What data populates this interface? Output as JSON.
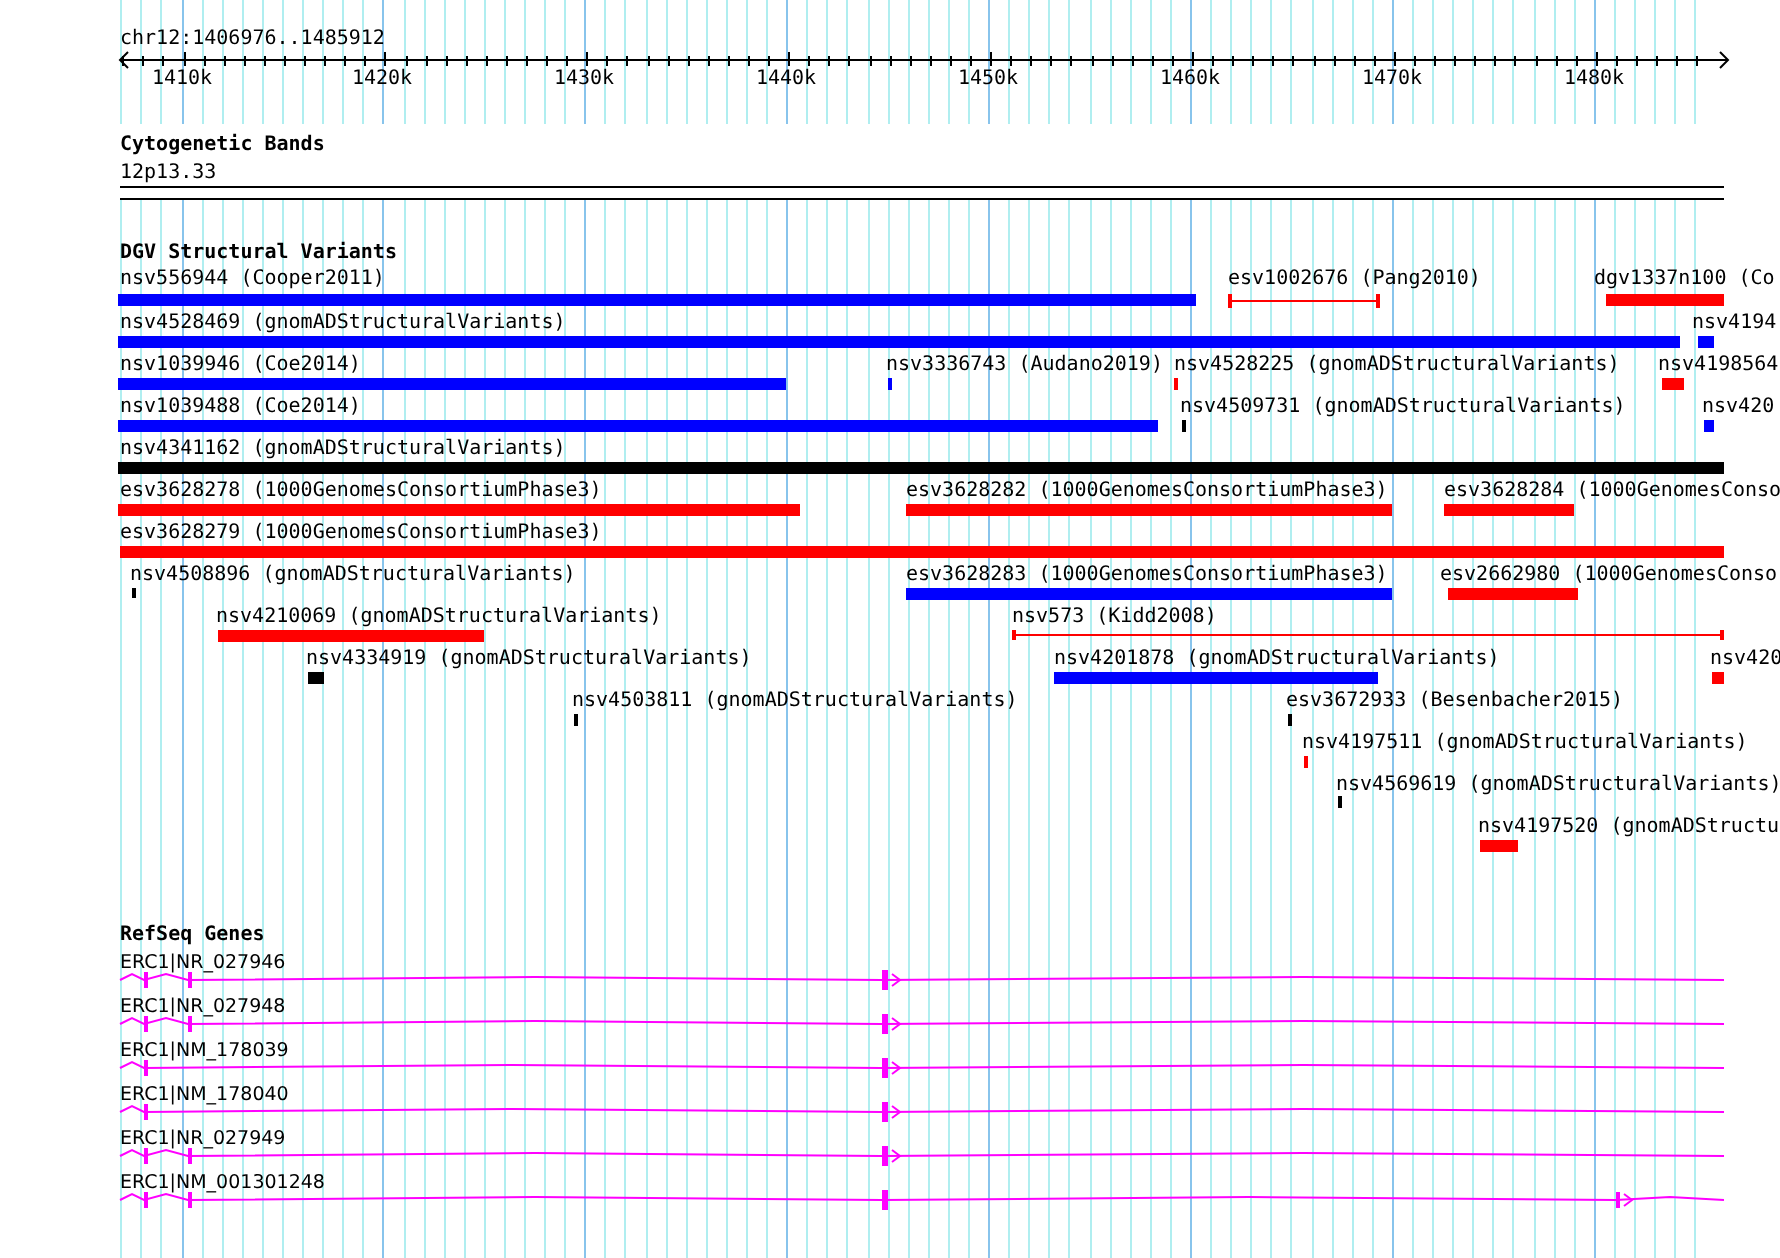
{
  "ruler": {
    "location": "chr12:1406976..1485912",
    "ticks": [
      "1410k",
      "1420k",
      "1430k",
      "1440k",
      "1450k",
      "1460k",
      "1470k",
      "1480k"
    ]
  },
  "cytogenetic_bands": {
    "title": "Cytogenetic Bands",
    "band": "12p13.33"
  },
  "dgv_structural_variants": {
    "title": "DGV Structural Variants",
    "features": [
      {
        "label": "nsv556944 (Cooper2011)",
        "color": "#0000ff",
        "kind": "bar"
      },
      {
        "label": "esv1002676 (Pang2010)",
        "color": "#ff0000",
        "kind": "span"
      },
      {
        "label": "dgv1337n100 (Co",
        "color": "#ff0000",
        "kind": "bar"
      },
      {
        "label": "nsv4528469 (gnomADStructuralVariants)",
        "color": "#0000ff",
        "kind": "bar"
      },
      {
        "label": "nsv4194",
        "color": "#0000ff",
        "kind": "bar"
      },
      {
        "label": "nsv1039946 (Coe2014)",
        "color": "#0000ff",
        "kind": "bar"
      },
      {
        "label": "nsv3336743 (Audano2019)",
        "color": "#0000ff",
        "kind": "bar"
      },
      {
        "label": "nsv4528225 (gnomADStructuralVariants)",
        "color": "#ff0000",
        "kind": "bar"
      },
      {
        "label": "nsv4198564",
        "color": "#ff0000",
        "kind": "bar"
      },
      {
        "label": "nsv1039488 (Coe2014)",
        "color": "#0000ff",
        "kind": "bar"
      },
      {
        "label": "nsv4509731 (gnomADStructuralVariants)",
        "color": "#000000",
        "kind": "bar"
      },
      {
        "label": "nsv420",
        "color": "#0000ff",
        "kind": "bar"
      },
      {
        "label": "nsv4341162 (gnomADStructuralVariants)",
        "color": "#000000",
        "kind": "bar"
      },
      {
        "label": "esv3628278 (1000GenomesConsortiumPhase3)",
        "color": "#ff0000",
        "kind": "bar"
      },
      {
        "label": "esv3628282 (1000GenomesConsortiumPhase3)",
        "color": "#ff0000",
        "kind": "bar"
      },
      {
        "label": "esv3628284 (1000GenomesConso",
        "color": "#ff0000",
        "kind": "bar"
      },
      {
        "label": "esv3628279 (1000GenomesConsortiumPhase3)",
        "color": "#ff0000",
        "kind": "bar"
      },
      {
        "label": "nsv4508896 (gnomADStructuralVariants)",
        "color": "#000000",
        "kind": "bar"
      },
      {
        "label": "esv3628283 (1000GenomesConsortiumPhase3)",
        "color": "#0000ff",
        "kind": "bar"
      },
      {
        "label": "esv2662980 (1000GenomesConso",
        "color": "#ff0000",
        "kind": "bar"
      },
      {
        "label": "nsv4210069 (gnomADStructuralVariants)",
        "color": "#ff0000",
        "kind": "bar"
      },
      {
        "label": "nsv573 (Kidd2008)",
        "color": "#ff0000",
        "kind": "span"
      },
      {
        "label": "nsv4334919 (gnomADStructuralVariants)",
        "color": "#000000",
        "kind": "bar"
      },
      {
        "label": "nsv4201878 (gnomADStructuralVariants)",
        "color": "#0000ff",
        "kind": "bar"
      },
      {
        "label": "nsv420",
        "color": "#ff0000",
        "kind": "bar"
      },
      {
        "label": "nsv4503811 (gnomADStructuralVariants)",
        "color": "#000000",
        "kind": "bar"
      },
      {
        "label": "esv3672933 (Besenbacher2015)",
        "color": "#000000",
        "kind": "bar"
      },
      {
        "label": "nsv4197511 (gnomADStructuralVariants)",
        "color": "#ff0000",
        "kind": "bar"
      },
      {
        "label": "nsv4569619 (gnomADStructuralVariants)",
        "color": "#000000",
        "kind": "bar"
      },
      {
        "label": "nsv4197520 (gnomADStructu",
        "color": "#ff0000",
        "kind": "bar"
      }
    ]
  },
  "refseq_genes": {
    "title": "RefSeq Genes",
    "transcripts": [
      {
        "label": "ERC1|NR_027946"
      },
      {
        "label": "ERC1|NR_027948"
      },
      {
        "label": "ERC1|NM_178039"
      },
      {
        "label": "ERC1|NM_178040"
      },
      {
        "label": "ERC1|NR_027949"
      },
      {
        "label": "ERC1|NM_001301248"
      }
    ]
  }
}
